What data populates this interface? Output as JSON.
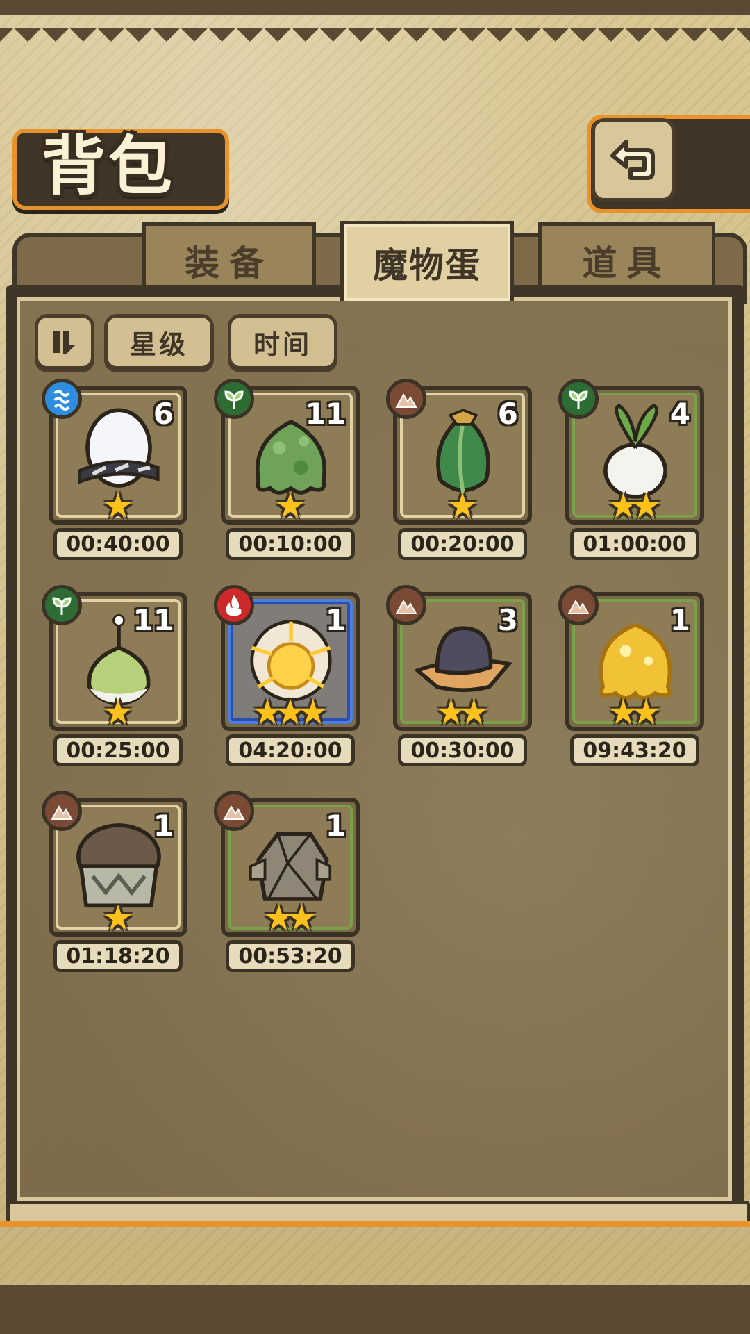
{
  "header": {
    "title": "背包",
    "back_icon": "return-arrow-icon"
  },
  "tabs": [
    {
      "label": "装备",
      "active": false
    },
    {
      "label": "魔物蛋",
      "active": true
    },
    {
      "label": "道具",
      "active": false
    }
  ],
  "filters": {
    "toggle_icon": "pause-sort-icon",
    "star_label": "星级",
    "time_label": "时间"
  },
  "colors": {
    "accent_orange": "#e8922c",
    "frame_dark": "#3f3628",
    "star_gold": "#ffc21a",
    "water": "#2d8ee0",
    "plant": "#2d6d34",
    "earth": "#7a4a34",
    "fire": "#cc2a2a"
  },
  "eggs": [
    {
      "name": "white-striped-egg",
      "type": "water",
      "count": "6",
      "stars": 1,
      "timer": "00:40:00",
      "frame": "beige"
    },
    {
      "name": "green-slime-egg",
      "type": "plant",
      "count": "11",
      "stars": 1,
      "timer": "00:10:00",
      "frame": "beige"
    },
    {
      "name": "leaf-bud-egg",
      "type": "earth",
      "count": "6",
      "stars": 1,
      "timer": "00:20:00",
      "frame": "beige"
    },
    {
      "name": "turnip-egg",
      "type": "plant",
      "count": "4",
      "stars": 2,
      "timer": "01:00:00",
      "frame": "green"
    },
    {
      "name": "green-bulb-egg",
      "type": "plant",
      "count": "11",
      "stars": 1,
      "timer": "00:25:00",
      "frame": "beige"
    },
    {
      "name": "sun-thunder-egg",
      "type": "fire",
      "count": "1",
      "stars": 3,
      "timer": "04:20:00",
      "frame": "blue"
    },
    {
      "name": "hat-rock-egg",
      "type": "earth",
      "count": "3",
      "stars": 2,
      "timer": "00:30:00",
      "frame": "green"
    },
    {
      "name": "gold-slime-egg",
      "type": "earth",
      "count": "1",
      "stars": 2,
      "timer": "09:43:20",
      "frame": "green"
    },
    {
      "name": "armored-dome-egg",
      "type": "earth",
      "count": "1",
      "stars": 1,
      "timer": "01:18:20",
      "frame": "beige"
    },
    {
      "name": "stone-golem-egg",
      "type": "earth",
      "count": "1",
      "stars": 2,
      "timer": "00:53:20",
      "frame": "green"
    }
  ]
}
